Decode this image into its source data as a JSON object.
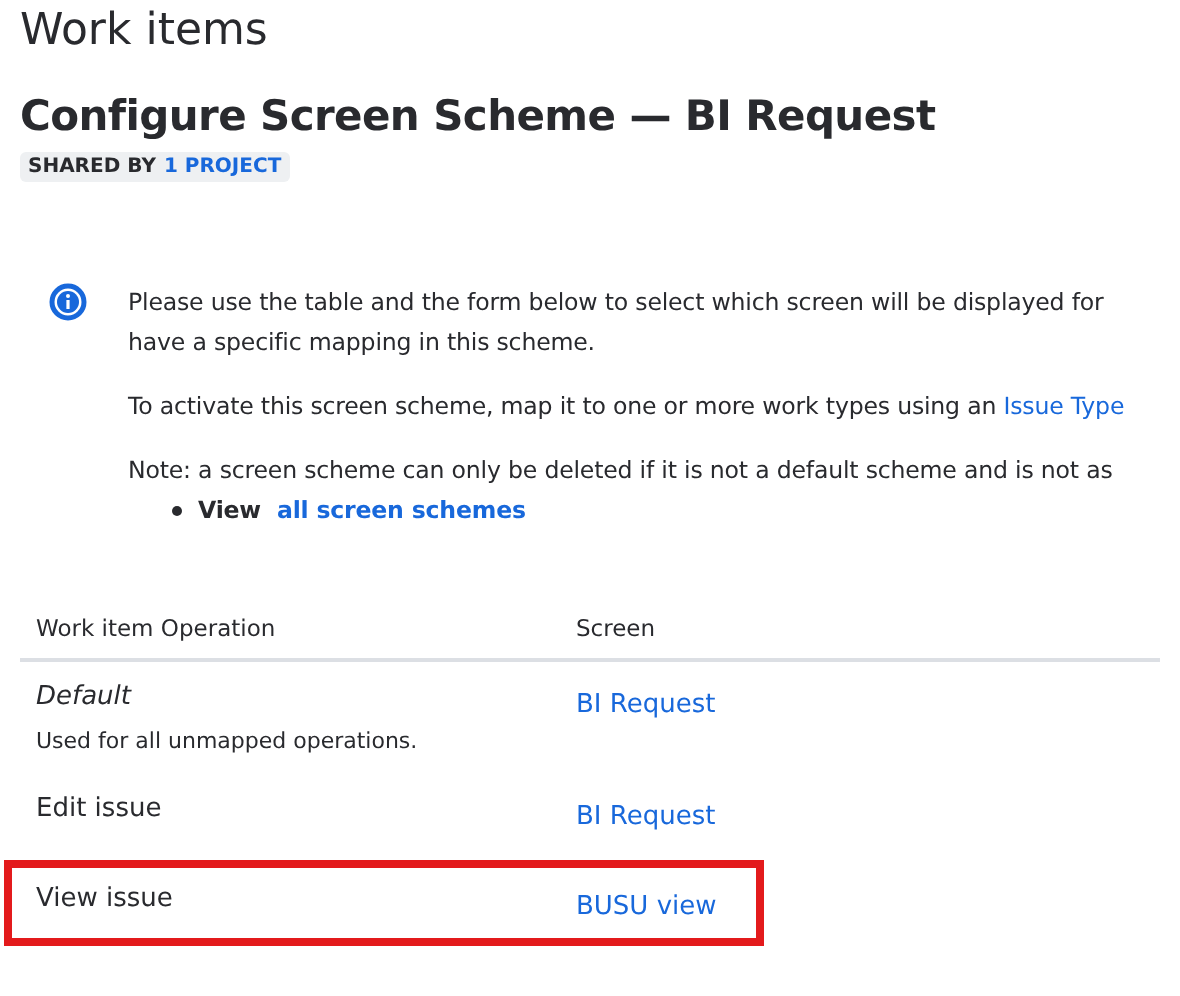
{
  "page_title": "Work items",
  "heading": "Configure Screen Scheme — BI Request",
  "badge": {
    "label": "SHARED BY",
    "link": "1 PROJECT"
  },
  "info": {
    "lines": [
      "Please use the table and the form below to select which screen will be displayed for",
      "have a specific mapping in this scheme."
    ],
    "activate": {
      "text": "To activate this screen scheme, map it to one or more work types using an",
      "link": "Issue Type"
    },
    "note": "Note: a screen scheme can only be deleted if it is not a default scheme and is not as",
    "bullet": {
      "text": "View",
      "link": "all screen schemes"
    }
  },
  "table": {
    "columns": [
      "Work item Operation",
      "Screen"
    ],
    "rows": [
      {
        "operation": "Default",
        "italic": true,
        "description": "Used for all unmapped operations.",
        "screen": "BI Request",
        "highlighted": false
      },
      {
        "operation": "Edit issue",
        "italic": false,
        "screen": "BI Request",
        "highlighted": false
      },
      {
        "operation": "View issue",
        "italic": false,
        "screen": "BUSU view",
        "highlighted": true
      }
    ]
  }
}
